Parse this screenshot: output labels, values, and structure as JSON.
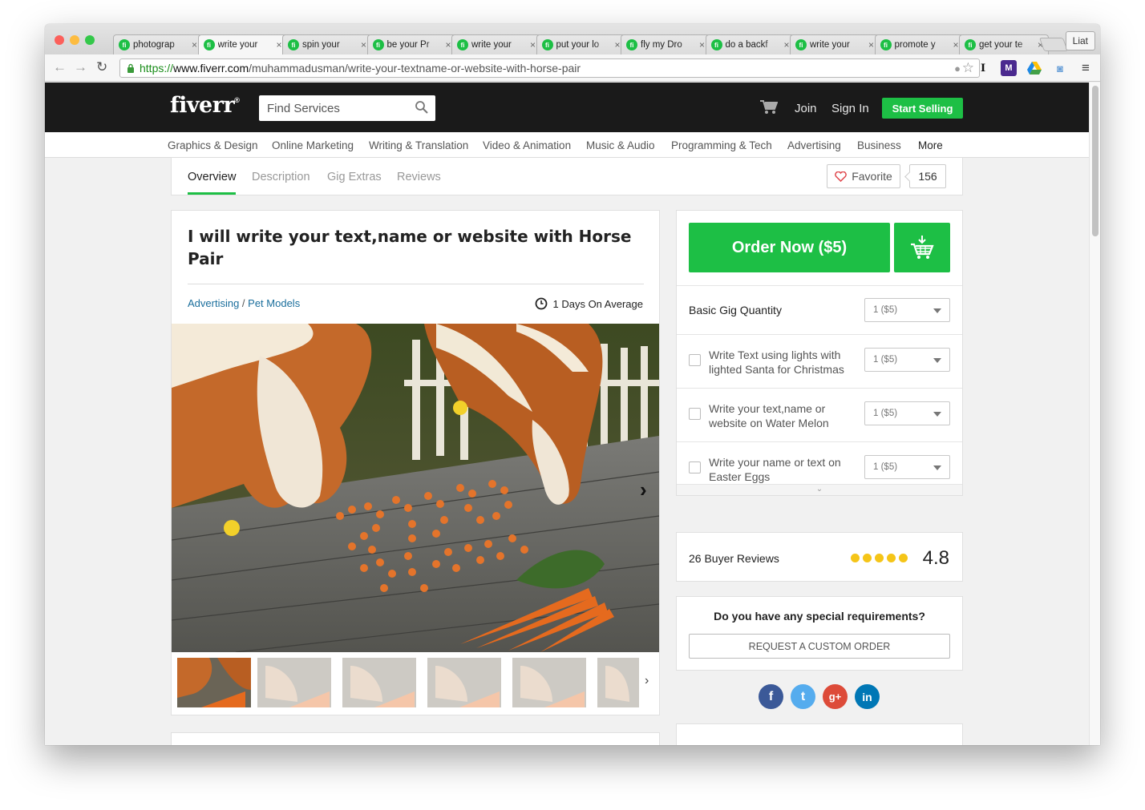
{
  "browser": {
    "tabs": [
      {
        "title": "photograp"
      },
      {
        "title": "write your"
      },
      {
        "title": "spin your"
      },
      {
        "title": "be your Pr"
      },
      {
        "title": "write your"
      },
      {
        "title": "put your lo"
      },
      {
        "title": "fly my Dro"
      },
      {
        "title": "do a backf"
      },
      {
        "title": "write your"
      },
      {
        "title": "promote y"
      },
      {
        "title": "get your te"
      }
    ],
    "active_tab_index": 1,
    "user_label": "Liat",
    "url_scheme": "https://",
    "url_domain": "www.fiverr.com",
    "url_path": "/muhammadusman/write-your-textname-or-website-with-horse-pair",
    "tab_favicon_letter": "fi"
  },
  "header": {
    "logo": "fiverr",
    "logo_mark": "®",
    "search_placeholder": "Find Services",
    "join": "Join",
    "sign_in": "Sign In",
    "start_selling": "Start Selling"
  },
  "categories": [
    "Graphics & Design",
    "Online Marketing",
    "Writing & Translation",
    "Video & Animation",
    "Music & Audio",
    "Programming & Tech",
    "Advertising",
    "Business",
    "More"
  ],
  "subnav": {
    "tabs": [
      "Overview",
      "Description",
      "Gig Extras",
      "Reviews"
    ],
    "active": "Overview",
    "favorite_label": "Favorite",
    "favorite_count": "156"
  },
  "gig": {
    "title": "I will write your text,name or website with Horse Pair",
    "category": "Advertising",
    "separator": " / ",
    "subcategory": "Pet Models",
    "delivery": "1 Days On Average",
    "gallery_count_shown": 6
  },
  "sidebar": {
    "order_button": "Order Now ($5)",
    "quantity_label": "Basic Gig Quantity",
    "quantity_value": "1 ($5)",
    "extras": [
      {
        "label": "Write Text using lights with lighted Santa for Christmas",
        "value": "1 ($5)"
      },
      {
        "label": "Write your text,name or website on Water Melon",
        "value": "1 ($5)"
      },
      {
        "label": "Write your name or text on Easter Eggs",
        "value": "1 ($5)"
      }
    ],
    "more_icon": "chevron-double-down-icon",
    "reviews_label": "26 Buyer Reviews",
    "rating": "4.8",
    "rating_stars": 5,
    "special_question": "Do you have any special requirements?",
    "custom_order": "REQUEST A CUSTOM ORDER"
  },
  "social": [
    {
      "name": "facebook",
      "glyph": "f",
      "color": "#3b5998"
    },
    {
      "name": "twitter",
      "glyph": "t",
      "color": "#55acee"
    },
    {
      "name": "google-plus",
      "glyph": "g+",
      "color": "#dd4b39"
    },
    {
      "name": "linkedin",
      "glyph": "in",
      "color": "#0077b5"
    }
  ],
  "colors": {
    "brand_green": "#1dbf45",
    "link_blue": "#1a6e9c",
    "star_yellow": "#f5c518",
    "header_black": "#1a1a1a"
  }
}
